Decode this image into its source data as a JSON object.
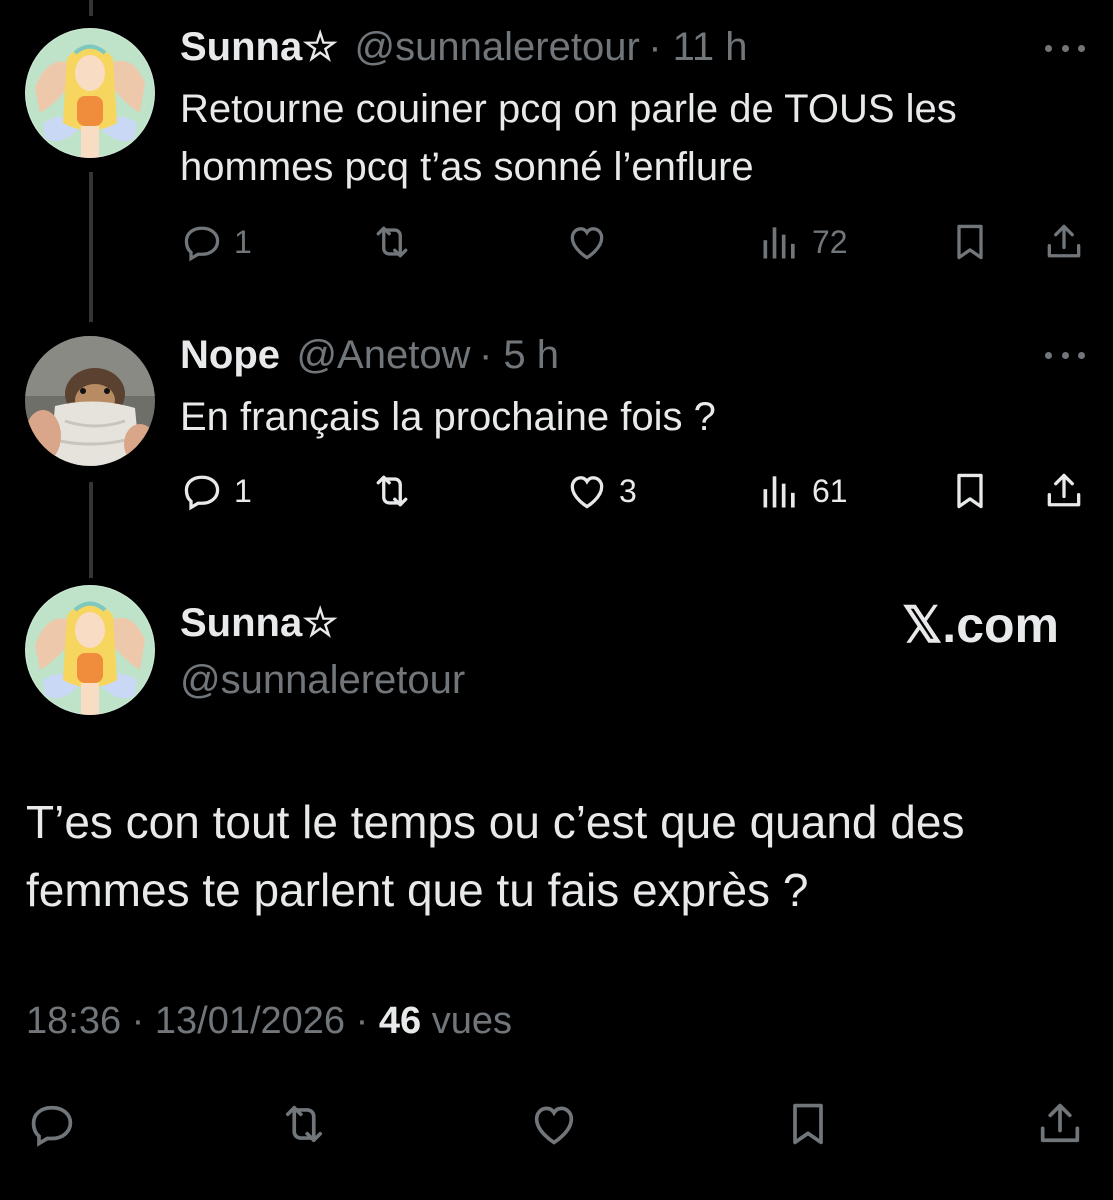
{
  "colors": {
    "background": "#000000",
    "text": "#e7e9ea",
    "secondary": "#71767b",
    "line": "#333639"
  },
  "replies": [
    {
      "avatar": "winx-fairy-avatar",
      "name": "Sunna☆",
      "handle": "@sunnaleretour",
      "time": "· 11 h",
      "text_lines": [
        "Retourne couiner pcq on parle de TOUS les",
        "hommes pcq t’as sonné l’enflure"
      ],
      "replies": "1",
      "retweets": "",
      "likes": "",
      "views": "72"
    },
    {
      "avatar": "guinea-pig-avatar",
      "name": "Nope",
      "handle": "@Anetow",
      "time": "· 5 h",
      "text_lines": [
        "En français la prochaine fois ?"
      ],
      "replies": "1",
      "retweets": "",
      "likes": "3",
      "views": "61"
    }
  ],
  "main_tweet": {
    "avatar": "winx-fairy-avatar",
    "name": "Sunna☆",
    "handle": "@sunnaleretour",
    "watermark": "𝕏.com",
    "text_lines": [
      "T’es con tout le temps ou c’est que quand des",
      "femmes te parlent que tu fais exprès ?"
    ],
    "time": "18:36",
    "date": "13/01/2026",
    "separator": "·",
    "views_count": "46",
    "views_label": "vues"
  }
}
